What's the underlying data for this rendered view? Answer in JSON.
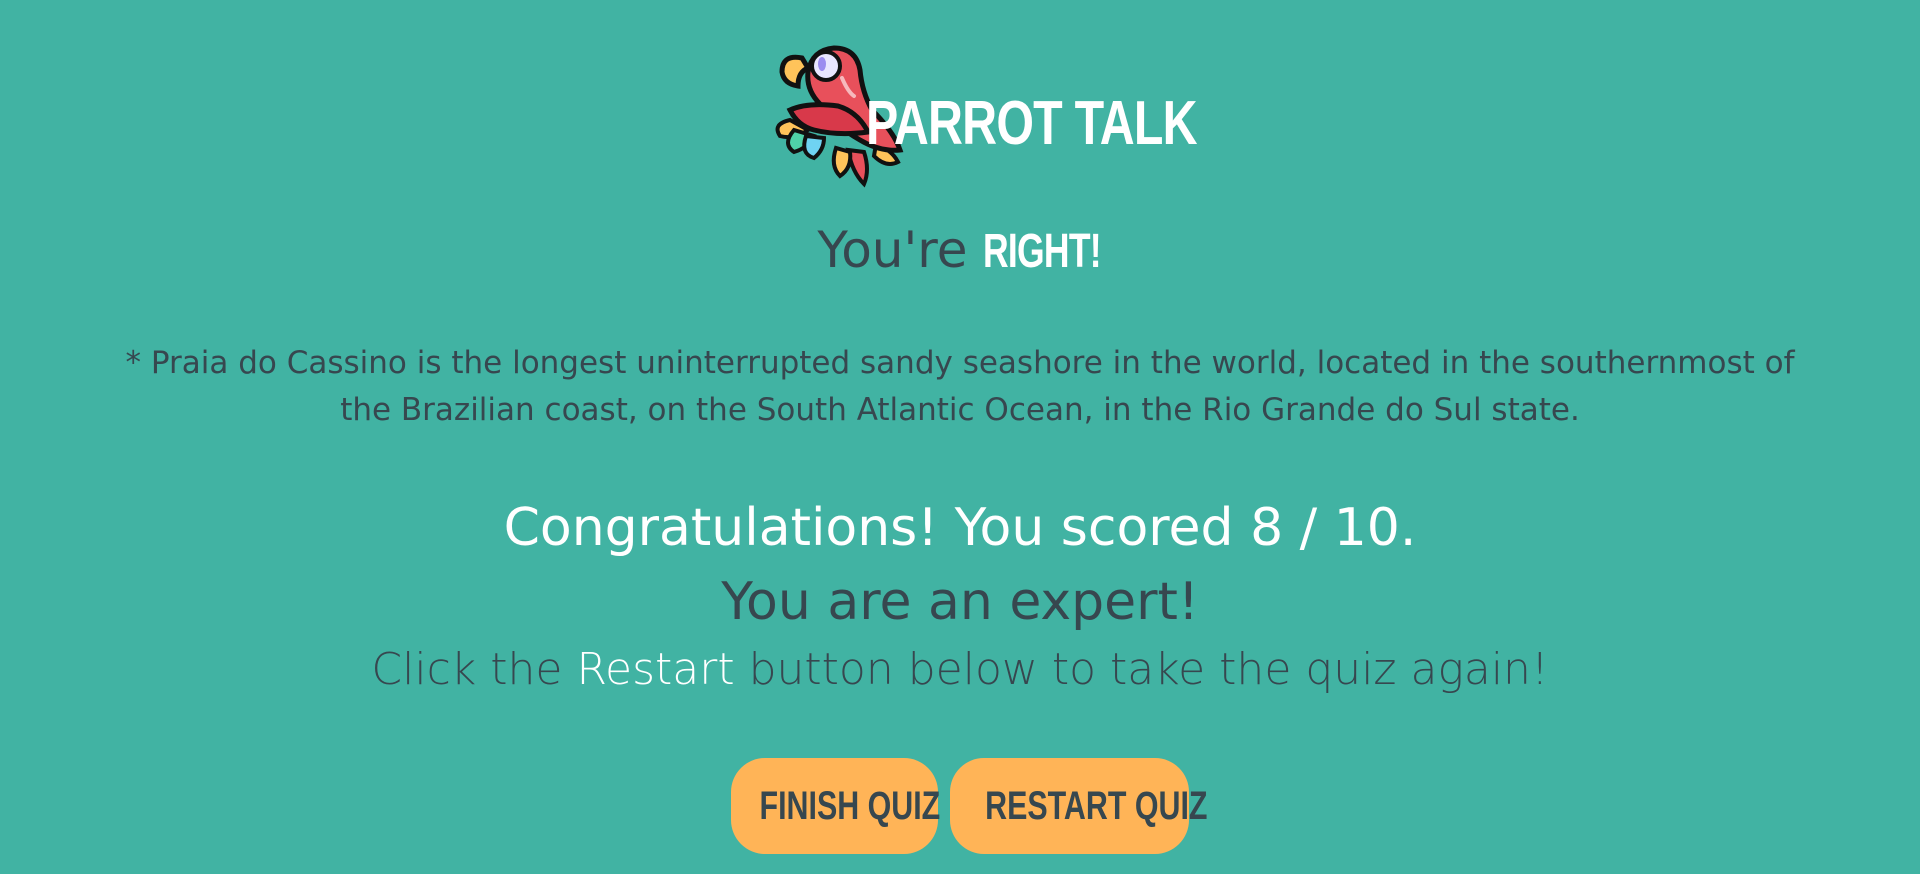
{
  "header": {
    "brand": "PARROT TALK",
    "logo_icon": "parrot-icon"
  },
  "result": {
    "prefix": "You're",
    "verdict": "RIGHT!"
  },
  "fact": {
    "text": "* Praia do Cassino is the longest uninterrupted sandy seashore in the world, located in the southernmost of the Brazilian coast, on the South Atlantic Ocean, in the Rio Grande do Sul state."
  },
  "summary": {
    "score_text": "Congratulations! You scored 8 / 10.",
    "level_text": "You are an expert!",
    "hint_before": "Click the",
    "hint_highlight": "Restart",
    "hint_after": "button below to take the quiz again!"
  },
  "buttons": {
    "finish_label": "FINISH QUIZ",
    "restart_label": "RESTART QUIZ"
  },
  "colors": {
    "background": "#41b3a3",
    "text_dark": "#37474f",
    "text_light": "#ffffff",
    "button": "#ffb457",
    "parrot_body": "#e8505b"
  }
}
